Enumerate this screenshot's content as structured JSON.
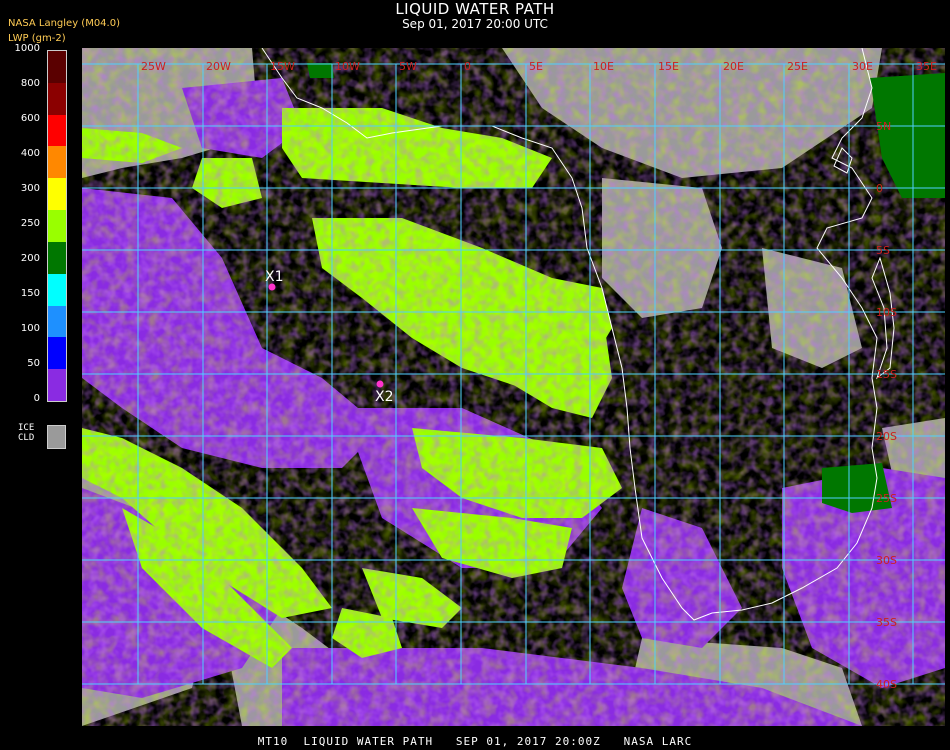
{
  "header": {
    "title": "LIQUID WATER PATH",
    "subtitle": "Sep 01, 2017 20:00 UTC"
  },
  "producer": "NASA Langley (M04.0)",
  "legend": {
    "unit_label": "LWP (gm-2)",
    "ticks": [
      "1000",
      "800",
      "600",
      "400",
      "300",
      "250",
      "200",
      "150",
      "100",
      "50",
      "0"
    ],
    "colors": [
      "#5a0000",
      "#8b0000",
      "#ff0000",
      "#ff8800",
      "#ffff00",
      "#99ff00",
      "#007700",
      "#00ffff",
      "#1e90ff",
      "#0000ff",
      "#8a2be2"
    ],
    "ice_label_1": "ICE",
    "ice_label_2": "CLD",
    "ice_color": "#9a9a9a"
  },
  "map": {
    "lon_labels": [
      "25W",
      "20W",
      "15W",
      "10W",
      "5W",
      "0",
      "5E",
      "10E",
      "15E",
      "20E",
      "25E",
      "30E",
      "35E"
    ],
    "lat_labels": [
      "5N",
      "0",
      "5S",
      "10S",
      "15S",
      "20S",
      "25S",
      "30S",
      "35S",
      "40S"
    ],
    "markers": [
      {
        "label": "X1"
      },
      {
        "label": "X2"
      }
    ],
    "colors": {
      "ocean": "#000000",
      "grid": "#4fd0ff",
      "coast": "#ffffff",
      "latlon_label": "#cc2020",
      "cloud_green": "#99ff00",
      "cloud_purple": "#8a2be2",
      "ice": "#9a9a9a",
      "dark_green": "#007700"
    }
  },
  "footer": "MT10  LIQUID WATER PATH   SEP 01, 2017 20:00Z   NASA LARC"
}
